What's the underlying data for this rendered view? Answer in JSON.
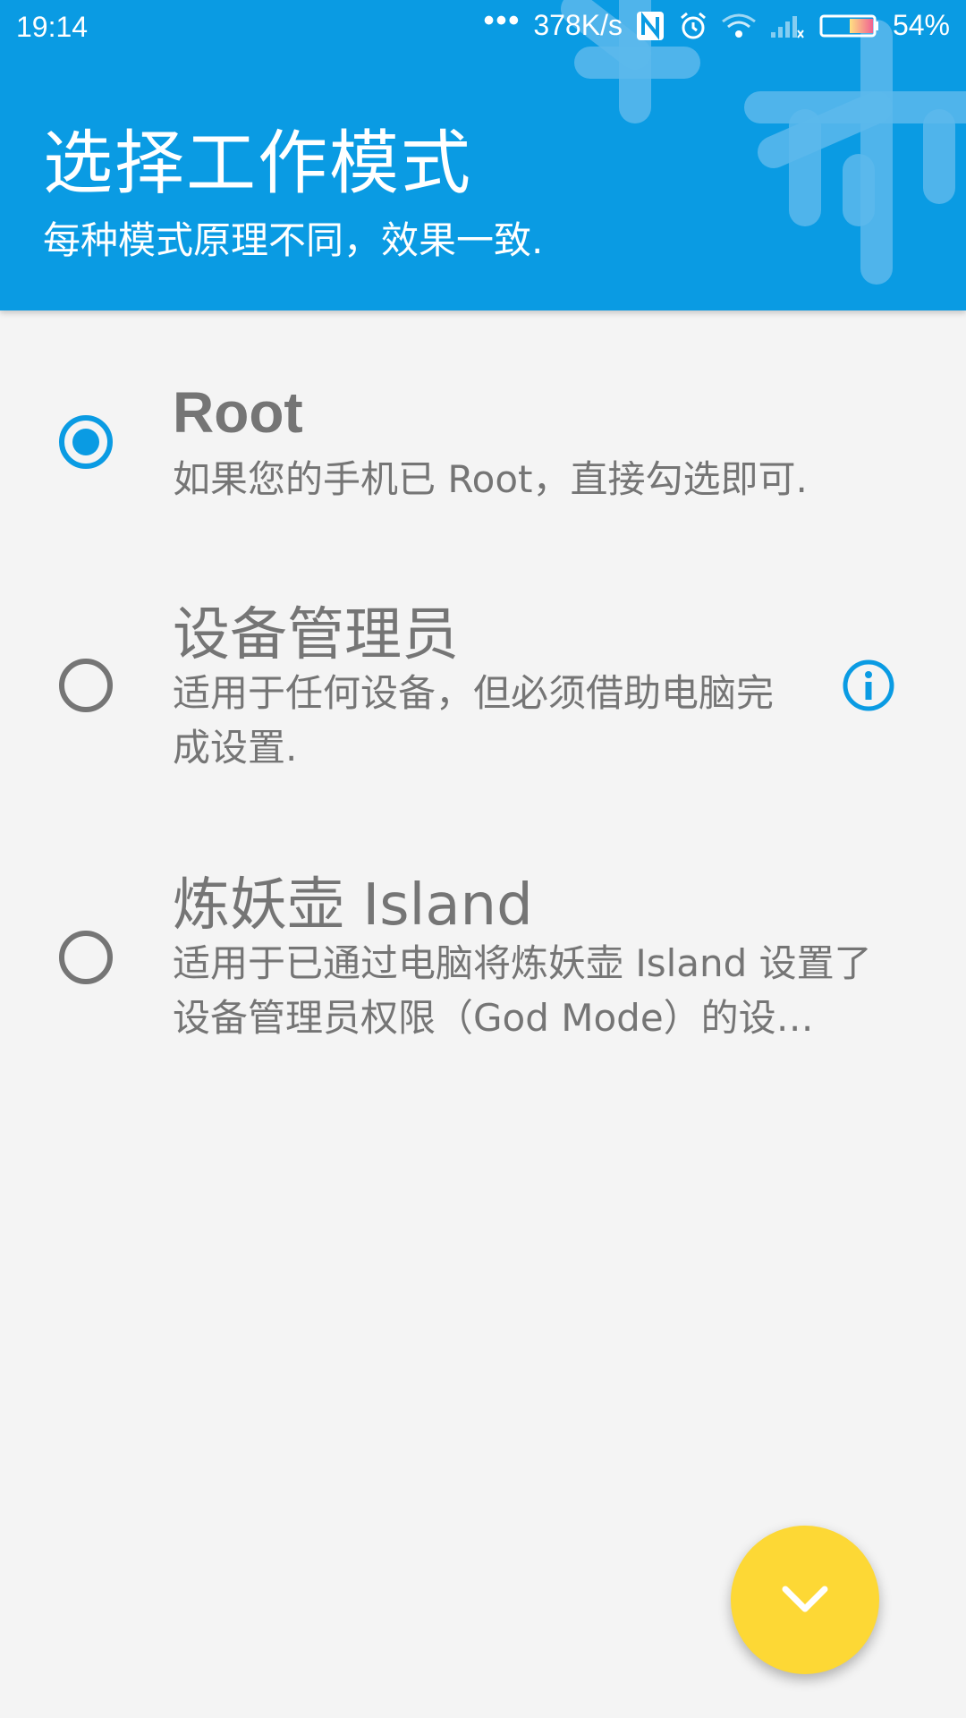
{
  "status_bar": {
    "time": "19:14",
    "dots": "•••",
    "speed": "378K/s",
    "battery": "54%",
    "icons": [
      "nfc-icon",
      "alarm-icon",
      "wifi-icon",
      "signal-icon",
      "battery-icon"
    ]
  },
  "header": {
    "title": "选择工作模式",
    "subtitle": "每种模式原理不同，效果一致.",
    "background_color": "#0a9be3"
  },
  "options": [
    {
      "title": "Root",
      "description": "如果您的手机已 Root，直接勾选即可.",
      "selected": true
    },
    {
      "title": "设备管理员",
      "description": "适用于任何设备，但必须借助电脑完成设置.",
      "selected": false,
      "info_icon": "info-icon"
    },
    {
      "title": "炼妖壶 Island",
      "description": "适用于已通过电脑将炼妖壶 Island 设置了设备管理员权限（God Mode）的设…",
      "selected": false
    }
  ],
  "fab": {
    "icon": "chevron-down-icon",
    "color": "#fdd835"
  },
  "colors": {
    "accent": "#0a9be3",
    "text_secondary": "#757575",
    "background": "#f4f4f4"
  }
}
